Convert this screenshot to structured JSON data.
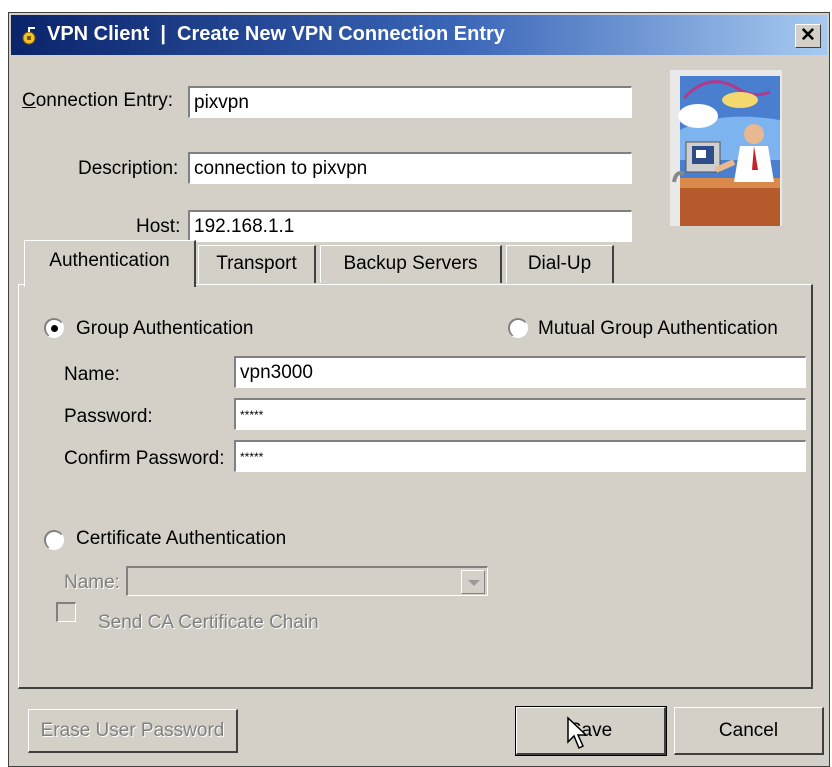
{
  "window": {
    "title": "VPN Client  |  Create New VPN Connection Entry",
    "close_glyph": "✕"
  },
  "form": {
    "connection_entry": {
      "label": "Connection Entry:",
      "value": "pixvpn"
    },
    "description": {
      "label": "Description:",
      "value": "connection to pixvpn"
    },
    "host": {
      "label": "Host:",
      "value": "192.168.1.1"
    }
  },
  "tabs": [
    {
      "label": "Authentication",
      "active": true
    },
    {
      "label": "Transport",
      "active": false
    },
    {
      "label": "Backup Servers",
      "active": false
    },
    {
      "label": "Dial-Up",
      "active": false
    }
  ],
  "auth": {
    "group_auth": {
      "label": "Group Authentication",
      "selected": true
    },
    "mutual_group_auth": {
      "label": "Mutual Group Authentication",
      "selected": false
    },
    "name": {
      "label": "Name:",
      "value": "vpn3000"
    },
    "password": {
      "label": "Password:",
      "value": "*****"
    },
    "confirm_password": {
      "label": "Confirm Password:",
      "value": "*****"
    },
    "certificate_auth": {
      "label": "Certificate Authentication",
      "selected": false
    },
    "cert_name": {
      "label": "Name:",
      "value": ""
    },
    "send_ca_chain": {
      "label": "Send CA Certificate Chain",
      "checked": false
    }
  },
  "buttons": {
    "erase_password": "Erase User Password",
    "save": "Save",
    "cancel": "Cancel"
  },
  "icons": {
    "app": "vpn-lock-icon",
    "logo": "vpn-client-illustration",
    "cursor": "mouse-pointer-icon"
  },
  "colors": {
    "titlebar_start": "#0a246a",
    "titlebar_end": "#a6caf0",
    "dialog_face": "#d4d0c8"
  }
}
